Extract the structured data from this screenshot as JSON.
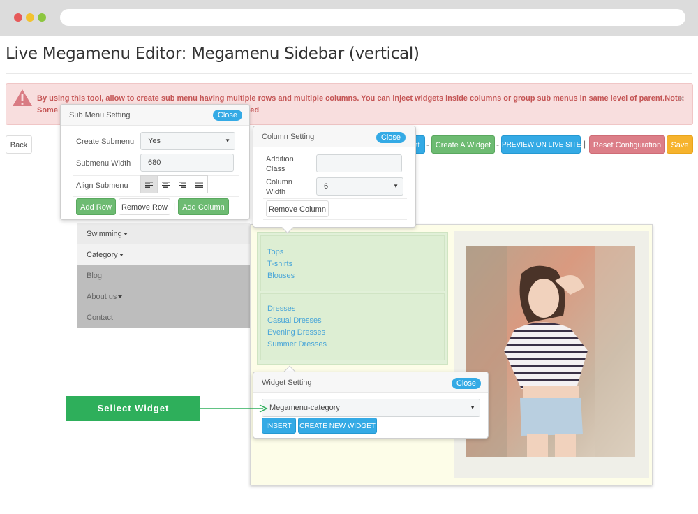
{
  "page_title": "Live Megamenu Editor: Megamenu Sidebar (vertical)",
  "alert": {
    "line1": "By using this tool, allow to create sub menu having multiple rows and multiple columns. You can inject widgets inside columns or group sub menus in same level of parent.Note:",
    "line2_start": "Some c",
    "line2_end": "overrided",
    "close": "×"
  },
  "toolbar": {
    "back": "Back",
    "partial": "et",
    "create_widget": "Create A Widget",
    "dash": "-",
    "preview": "PREVIEW ON LIVE SITE",
    "pipe": "|",
    "reset": "Reset Configuration",
    "save": "Save"
  },
  "submenu_setting": {
    "title": "Sub Menu Setting",
    "close": "Close",
    "create_label": "Create Submenu",
    "create_value": "Yes",
    "width_label": "Submenu Width",
    "width_value": "680",
    "align_label": "Align Submenu",
    "add_row": "Add Row",
    "remove_row": "Remove Row",
    "pipe": "|",
    "add_column": "Add Column"
  },
  "column_setting": {
    "title": "Column Setting",
    "close": "Close",
    "class_label_1": "Addition",
    "class_label_2": "Class",
    "class_value": "",
    "width_label_1": "Column",
    "width_label_2": "Width",
    "width_value": "6",
    "remove_column": "Remove Column"
  },
  "menu": {
    "items": [
      "Swimming",
      "Category",
      "Blog",
      "About us",
      "Contact"
    ]
  },
  "categories": {
    "group1": [
      "Tops",
      "T-shirts",
      "Blouses"
    ],
    "group2": [
      "Dresses",
      "Casual Dresses",
      "Evening Dresses",
      "Summer Dresses"
    ]
  },
  "widget_setting": {
    "title": "Widget Setting",
    "close": "Close",
    "selected": "Megamenu-category",
    "insert": "INSERT",
    "create_new": "CREATE NEW WIDGET"
  },
  "callout": "Sellect Widget",
  "colors": {
    "accent_blue": "#34aae5",
    "green": "#6dbb72",
    "callout_green": "#2eaf5b",
    "alert_bg": "#f8dede"
  }
}
